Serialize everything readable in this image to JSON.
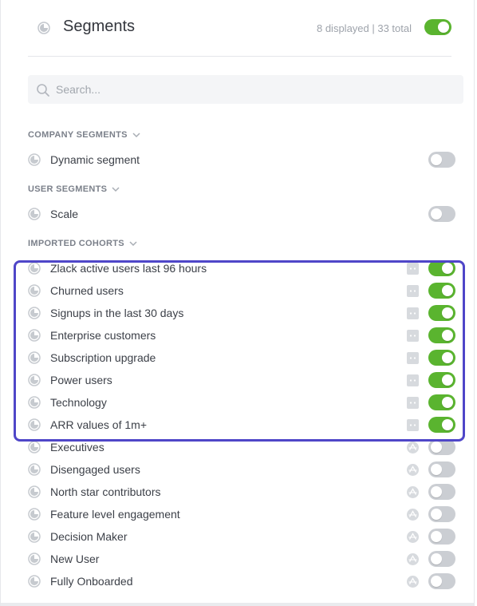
{
  "header": {
    "title": "Segments",
    "counts": "8 displayed | 33 total",
    "toggle_on": true
  },
  "search": {
    "placeholder": "Search..."
  },
  "sections": [
    {
      "title": "COMPANY SEGMENTS",
      "items": [
        {
          "label": "Dynamic segment",
          "source": "",
          "on": false
        }
      ]
    },
    {
      "title": "USER SEGMENTS",
      "items": [
        {
          "label": "Scale",
          "source": "",
          "on": false
        }
      ]
    },
    {
      "title": "IMPORTED COHORTS",
      "items": [
        {
          "label": "Zlack active users last 96 hours",
          "source": "import-icon",
          "on": true
        },
        {
          "label": "Churned users",
          "source": "import-icon",
          "on": true
        },
        {
          "label": "Signups in the last 30 days",
          "source": "import-icon",
          "on": true
        },
        {
          "label": "Enterprise customers",
          "source": "import-icon",
          "on": true
        },
        {
          "label": "Subscription upgrade",
          "source": "import-icon",
          "on": true
        },
        {
          "label": "Power users",
          "source": "import-icon",
          "on": true
        },
        {
          "label": "Technology",
          "source": "import-icon",
          "on": true
        },
        {
          "label": "ARR values of 1m+",
          "source": "import-icon",
          "on": true
        },
        {
          "label": "Executives",
          "source": "amplitude-icon",
          "on": false
        },
        {
          "label": "Disengaged users",
          "source": "amplitude-icon",
          "on": false
        },
        {
          "label": "North star contributors",
          "source": "amplitude-icon",
          "on": false
        },
        {
          "label": "Feature level engagement",
          "source": "amplitude-icon",
          "on": false
        },
        {
          "label": "Decision Maker",
          "source": "amplitude-icon",
          "on": false
        },
        {
          "label": "New User",
          "source": "amplitude-icon",
          "on": false
        },
        {
          "label": "Fully Onboarded",
          "source": "amplitude-icon",
          "on": false
        }
      ]
    }
  ],
  "colors": {
    "toggle_on": "#5ab42f",
    "toggle_off": "#cbced3",
    "highlight_border": "#4f46c8"
  }
}
